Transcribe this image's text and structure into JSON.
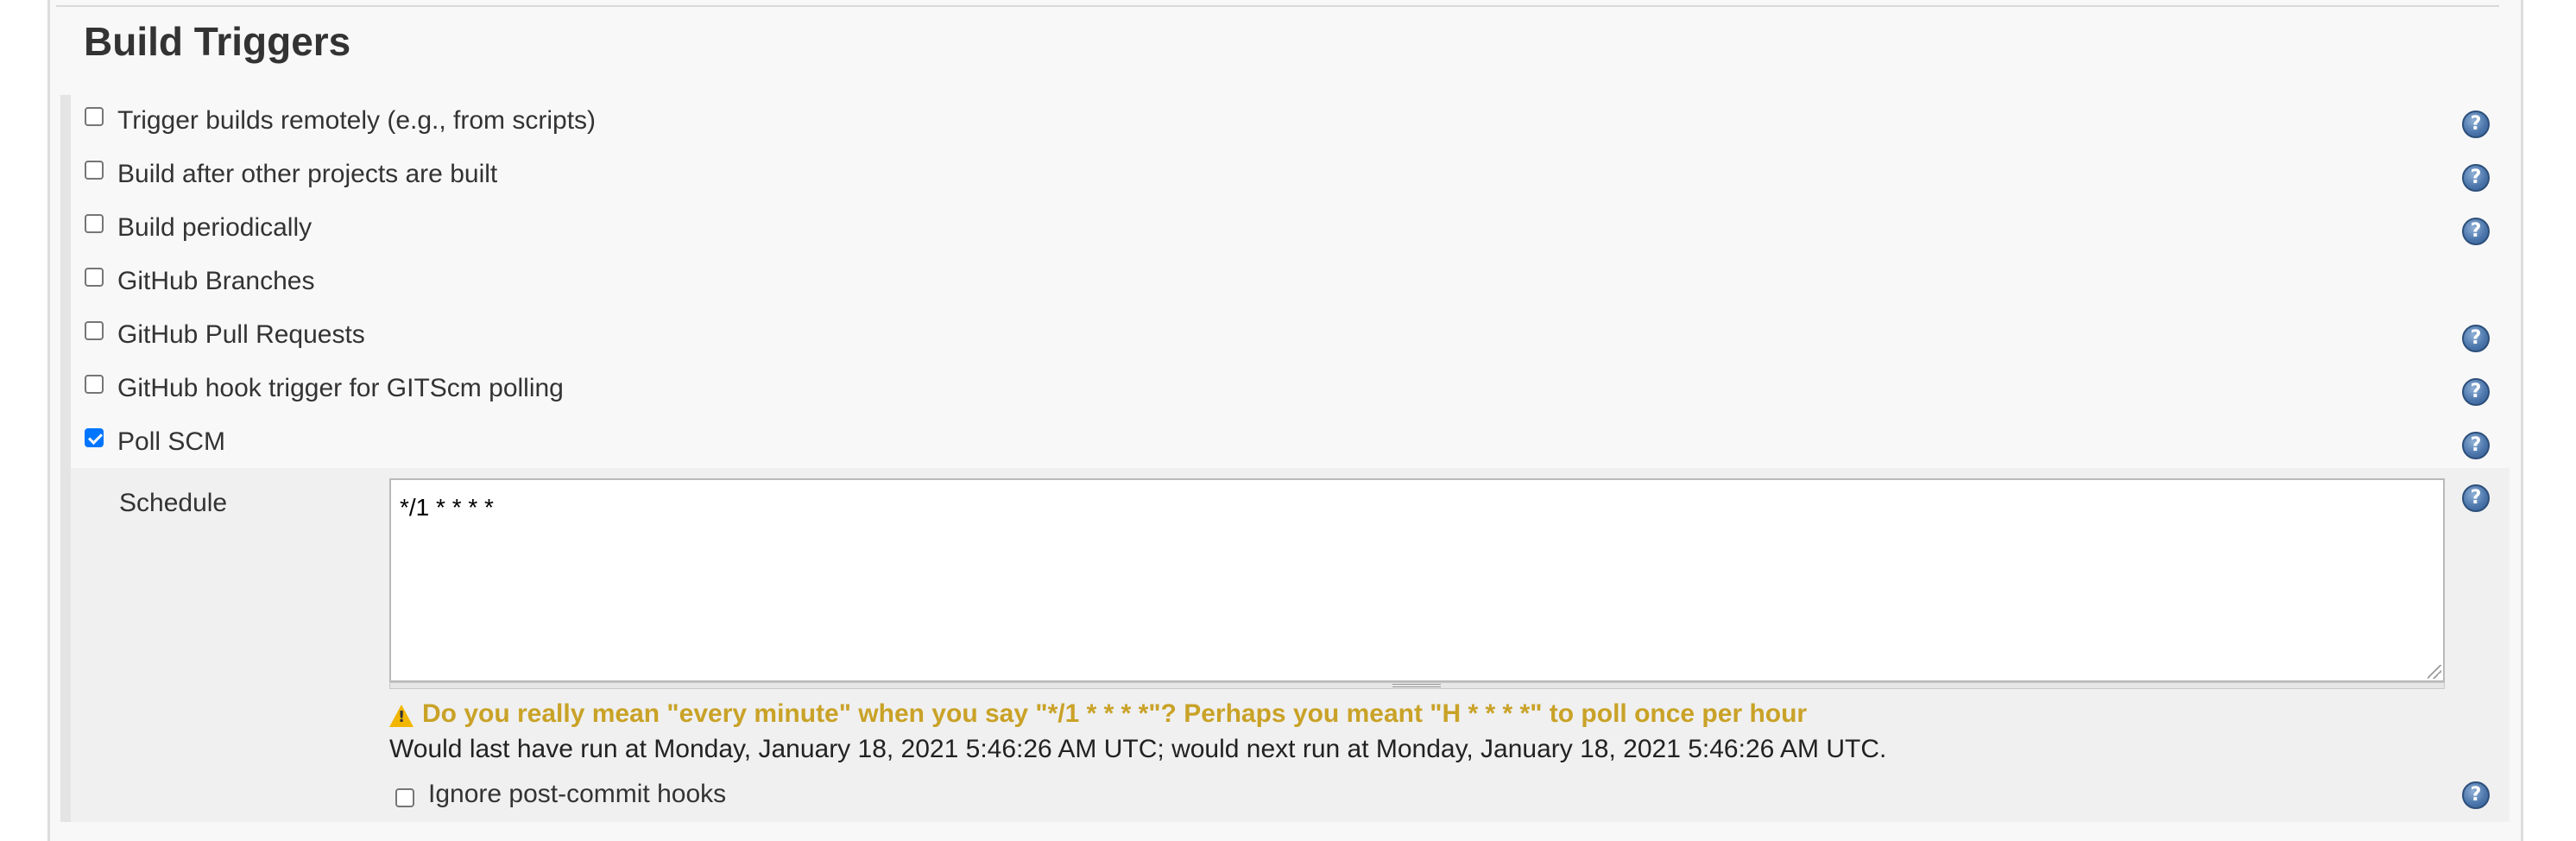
{
  "section": {
    "title": "Build Triggers"
  },
  "options": [
    {
      "label": "Trigger builds remotely (e.g., from scripts)",
      "checked": false,
      "help": true
    },
    {
      "label": "Build after other projects are built",
      "checked": false,
      "help": true
    },
    {
      "label": "Build periodically",
      "checked": false,
      "help": true
    },
    {
      "label": "GitHub Branches",
      "checked": false,
      "help": false
    },
    {
      "label": "GitHub Pull Requests",
      "checked": false,
      "help": true
    },
    {
      "label": "GitHub hook trigger for GITScm polling",
      "checked": false,
      "help": true
    },
    {
      "label": "Poll SCM",
      "checked": true,
      "help": true
    }
  ],
  "poll_scm": {
    "schedule_label": "Schedule",
    "schedule_value": "*/1 * * * *",
    "warning": "Do you really mean \"every minute\" when you say \"*/1 * * * *\"? Perhaps you meant \"H * * * *\" to poll once per hour",
    "run_info": "Would last have run at Monday, January 18, 2021 5:46:26 AM UTC; would next run at Monday, January 18, 2021 5:46:26 AM UTC.",
    "ignore_hooks_label": "Ignore post-commit hooks",
    "ignore_hooks_checked": false
  },
  "help_icon_glyph": "?",
  "colors": {
    "warning_text": "#c9a227",
    "checkbox_checked": "#0075ff",
    "help_icon": "#4e78ad"
  }
}
